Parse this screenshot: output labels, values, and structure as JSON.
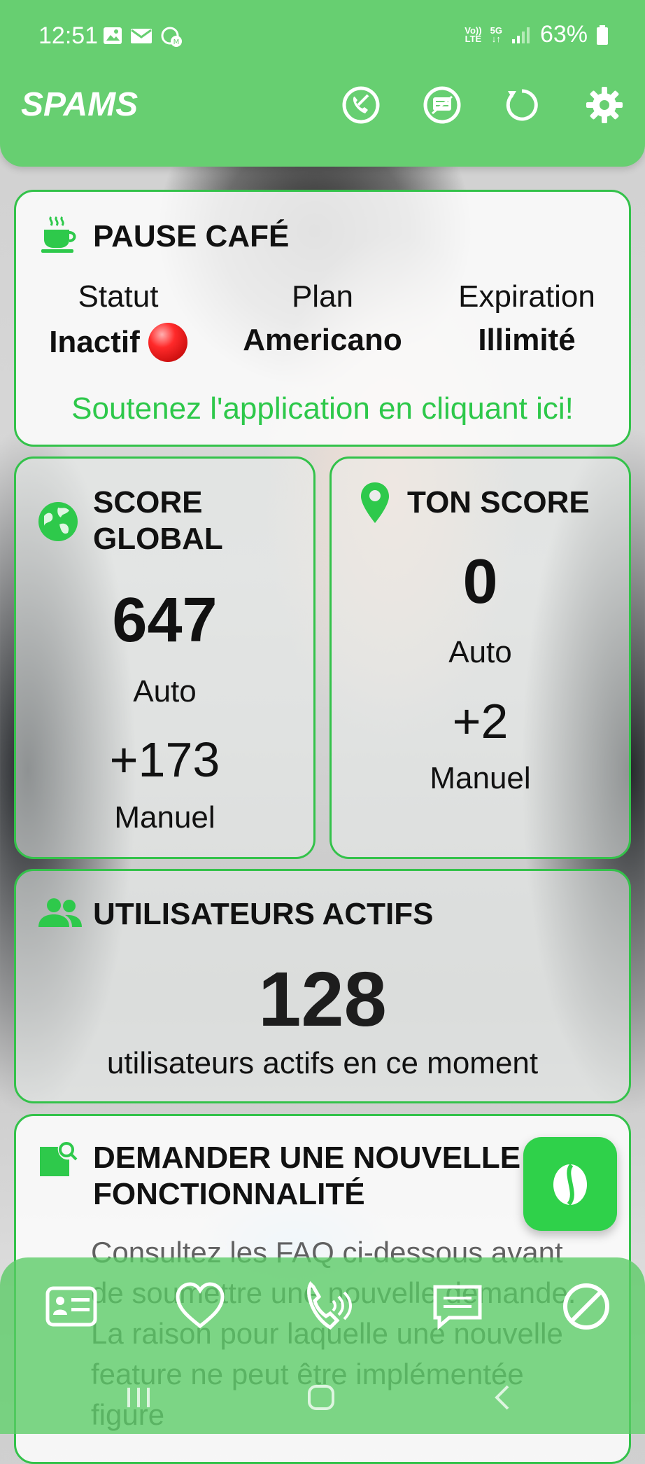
{
  "status_bar": {
    "time": "12:51",
    "volte": [
      "Vo))",
      "LTE"
    ],
    "network": "5G",
    "battery": "63%"
  },
  "header": {
    "app_name": "SPAMS",
    "icons": [
      "phone-blocked-icon",
      "message-blocked-icon",
      "refresh-icon",
      "settings-icon"
    ]
  },
  "coffee": {
    "title": "PAUSE CAFÉ",
    "status_label": "Statut",
    "status_value": "Inactif",
    "plan_label": "Plan",
    "plan_value": "Americano",
    "expiration_label": "Expiration",
    "expiration_value": "Illimité",
    "support_text": "Soutenez l'application en cliquant ici!"
  },
  "global_score": {
    "title_line1": "SCORE",
    "title_line2": "GLOBAL",
    "auto_value": "647",
    "auto_label": "Auto",
    "manual_value": "+173",
    "manual_label": "Manuel"
  },
  "your_score": {
    "title": "TON SCORE",
    "auto_value": "0",
    "auto_label": "Auto",
    "manual_value": "+2",
    "manual_label": "Manuel"
  },
  "active_users": {
    "title": "UTILISATEURS ACTIFS",
    "count": "128",
    "caption": "utilisateurs actifs en ce moment"
  },
  "feature_request": {
    "title_line1": "DEMANDER UNE NOUVELLE",
    "title_line2": "FONCTIONNALITÉ",
    "text": "Consultez les FAQ ci-dessous avant de soumettre une nouvelle demande. La raison pour laquelle une nouvelle feature ne peut être implémentée figure"
  },
  "bottom_nav": {
    "items": [
      "contact-card-icon",
      "heart-icon",
      "phone-call-icon",
      "message-icon",
      "block-icon"
    ]
  },
  "colors": {
    "accent": "#67cf71",
    "accent_dark": "#33c24a",
    "support_green": "#2dc84a"
  }
}
